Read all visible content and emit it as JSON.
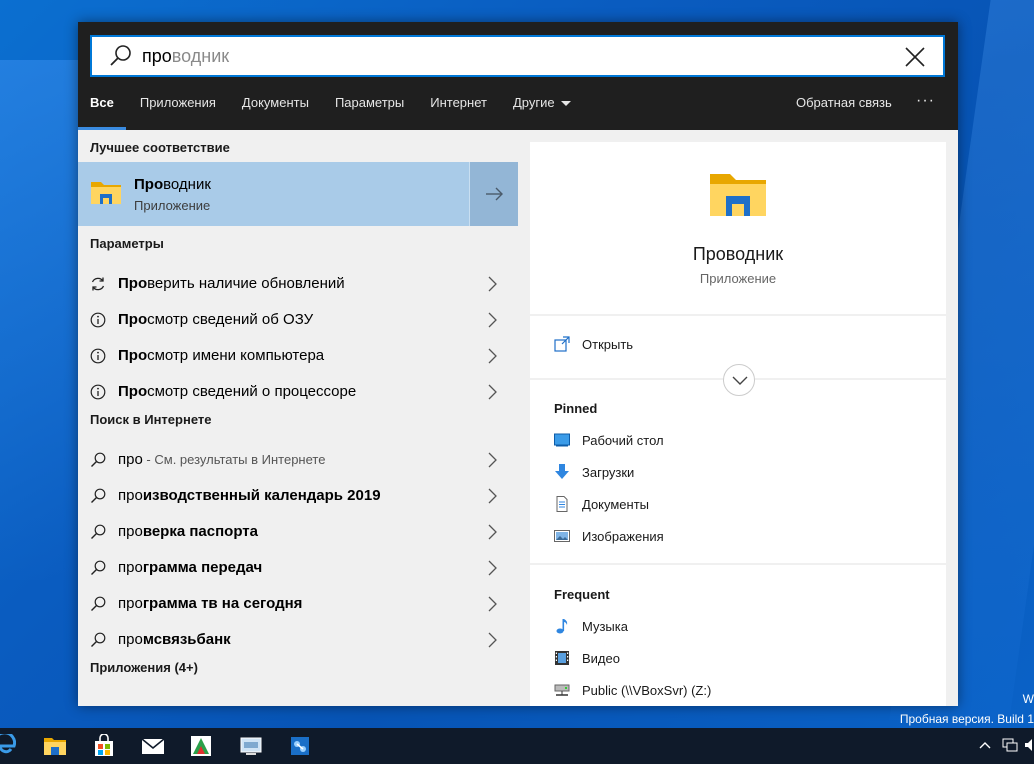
{
  "search": {
    "typed": "про",
    "hint": "водник"
  },
  "tabs": [
    {
      "label": "Все"
    },
    {
      "label": "Приложения"
    },
    {
      "label": "Документы"
    },
    {
      "label": "Параметры"
    },
    {
      "label": "Интернет"
    },
    {
      "label": "Другие"
    }
  ],
  "header": {
    "feedback": "Обратная связь",
    "more": "···"
  },
  "best_match": {
    "heading": "Лучшее соответствие",
    "title_bold": "Про",
    "title_rest": "водник",
    "subtitle": "Приложение"
  },
  "settings": {
    "heading": "Параметры",
    "items": [
      {
        "bold": "Про",
        "rest": "верить наличие обновлений"
      },
      {
        "bold": "Про",
        "rest": "смотр сведений об ОЗУ"
      },
      {
        "bold": "Про",
        "rest": "смотр имени компьютера"
      },
      {
        "bold": "Про",
        "rest": "смотр сведений о процессоре"
      }
    ]
  },
  "web": {
    "heading": "Поиск в Интернете",
    "first_query": "про",
    "first_suffix": " - См. результаты в Интернете",
    "items": [
      {
        "plain": "про",
        "bold": "изводственный календарь 2019"
      },
      {
        "plain": "про",
        "bold": "верка паспорта"
      },
      {
        "plain": "про",
        "bold": "грамма передач"
      },
      {
        "plain": "про",
        "bold": "грамма тв на сегодня"
      },
      {
        "plain": "про",
        "bold": "мсвязьбанк"
      }
    ]
  },
  "apps_more": "Приложения (4+)",
  "preview": {
    "title": "Проводник",
    "subtitle": "Приложение",
    "open": "Открыть",
    "pinned_heading": "Pinned",
    "pinned": [
      {
        "label": "Рабочий стол",
        "icon": "desktop-icon"
      },
      {
        "label": "Загрузки",
        "icon": "download-icon"
      },
      {
        "label": "Документы",
        "icon": "document-icon"
      },
      {
        "label": "Изображения",
        "icon": "pictures-icon"
      }
    ],
    "frequent_heading": "Frequent",
    "frequent": [
      {
        "label": "Музыка",
        "icon": "music-icon"
      },
      {
        "label": "Видео",
        "icon": "video-icon"
      },
      {
        "label": "Public (\\\\VBoxSvr) (Z:)",
        "icon": "network-drive-icon"
      }
    ]
  },
  "watermark": {
    "line1": "W",
    "line2": "Пробная версия. Build 1"
  },
  "colors": {
    "accent": "#0078d7",
    "selected": "#a9cbe8",
    "panel_header": "#1f1f1f",
    "taskbar": "#0f1a2a"
  }
}
